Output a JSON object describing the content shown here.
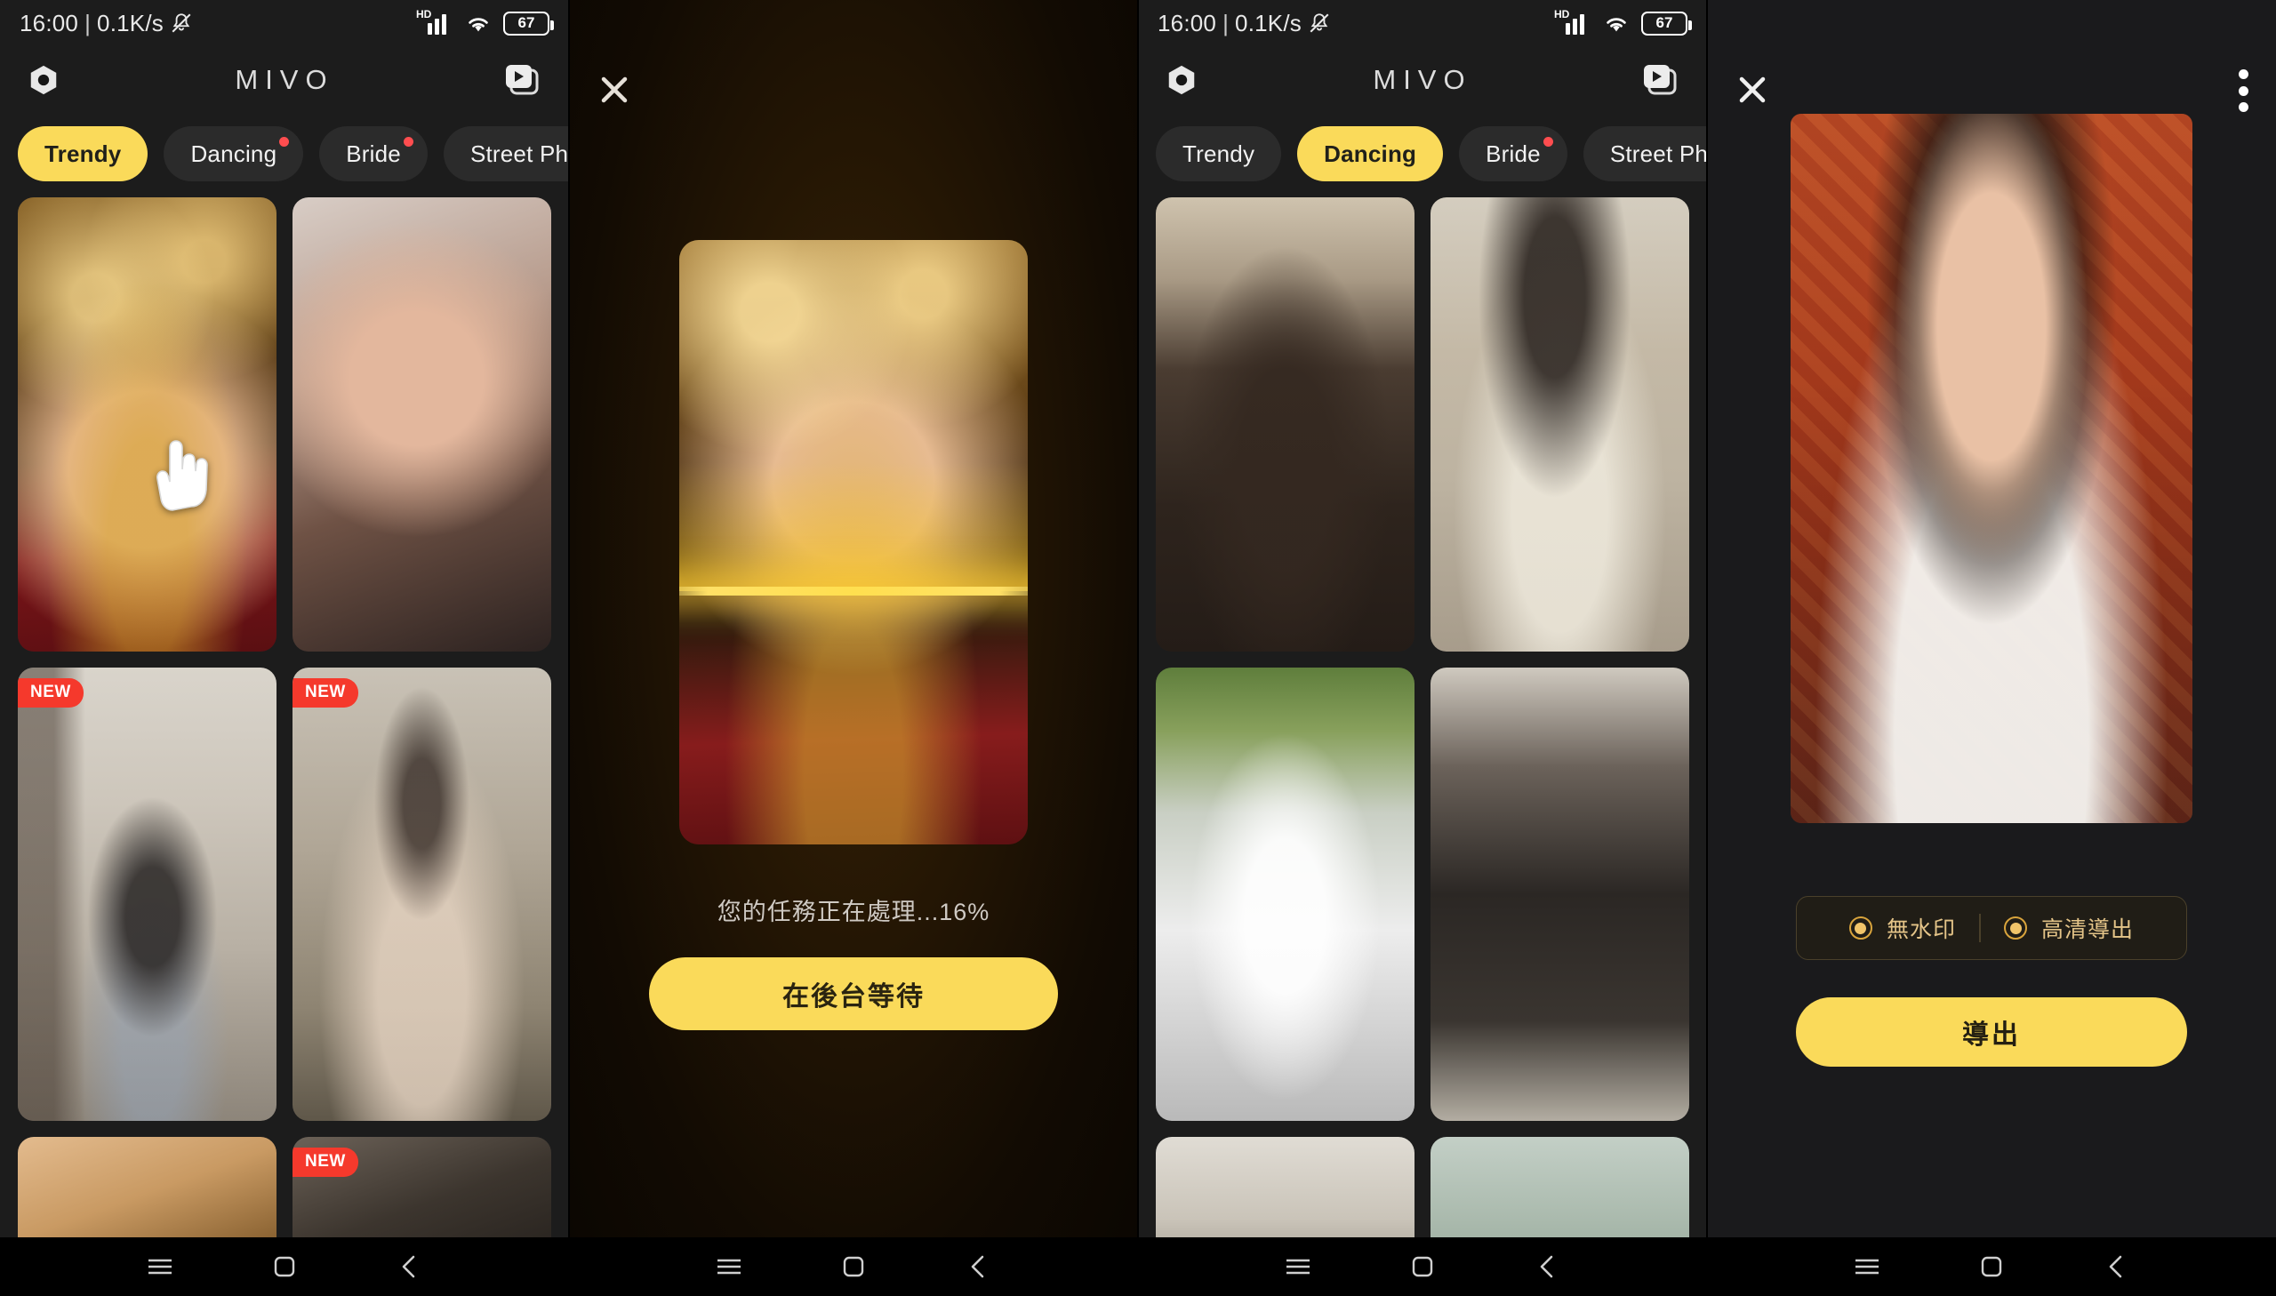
{
  "status_bar": {
    "time": "16:00",
    "separator": "|",
    "network_speed": "0.1K/s",
    "mute_icon": "bell-mute-icon",
    "signal_label": "HD",
    "signal_icon": "signal-bars-icon",
    "wifi_icon": "wifi-icon",
    "battery_level": "67"
  },
  "app": {
    "brand": "MIVO",
    "logo_icon": "hexagon-logo-icon",
    "video_button_icon": "video-stack-play-icon",
    "close_icon": "close-x-icon",
    "more_icon": "kebab-menu-icon",
    "cursor_icon": "pointing-hand-cursor-icon"
  },
  "tabs": {
    "items": [
      {
        "label": "Trendy",
        "badge": false
      },
      {
        "label": "Dancing",
        "badge": true
      },
      {
        "label": "Bride",
        "badge": true
      },
      {
        "label": "Street Photograph",
        "badge": false
      }
    ],
    "panel1_active": "Trendy",
    "panel3_active": "Dancing"
  },
  "panel1": {
    "name": "template-gallery-trendy",
    "cards": [
      {
        "id": "c1",
        "badge": "",
        "alt": "indian-bride-gold-jewelry"
      },
      {
        "id": "c2",
        "badge": "",
        "alt": "woman-portrait-hand-on-face"
      },
      {
        "id": "c3",
        "badge": "NEW",
        "alt": "woman-black-top-denim-shorts"
      },
      {
        "id": "c4",
        "badge": "NEW",
        "alt": "woman-vintage-lace-gown"
      },
      {
        "id": "c5",
        "badge": "",
        "alt": "gold-bangles-closeup"
      },
      {
        "id": "c6",
        "badge": "NEW",
        "alt": "woman-dark-hair-video"
      }
    ]
  },
  "panel2": {
    "name": "processing-overlay",
    "progress_text": "您的任務正在處理...16%",
    "progress_percent": 16,
    "wait_button": "在後台等待",
    "preview_alt": "indian-bride-gold-jewelry-processing"
  },
  "panel3": {
    "name": "template-gallery-dancing",
    "cards": [
      {
        "id": "d1",
        "badge": "",
        "alt": "young-man-brown-hoodie-dancing"
      },
      {
        "id": "d2",
        "badge": "",
        "alt": "woman-cream-sweater-hand-up"
      },
      {
        "id": "d3",
        "badge": "",
        "alt": "woman-white-tee-nyc-cap"
      },
      {
        "id": "d4",
        "badge": "",
        "alt": "woman-black-fur-jacket"
      },
      {
        "id": "d5",
        "badge": "",
        "alt": "woman-mirror-selfie"
      },
      {
        "id": "d6",
        "badge": "",
        "alt": "green-wall-clip"
      }
    ]
  },
  "panel4": {
    "name": "export-screen",
    "preview_alt": "woman-white-blouse-red-backdrop-result",
    "options": [
      {
        "label": "無水印",
        "selected": true,
        "icon": "radio-selected-icon"
      },
      {
        "label": "高清導出",
        "selected": true,
        "icon": "radio-selected-icon"
      }
    ],
    "export_button": "導出"
  },
  "nav_bar": {
    "items": [
      {
        "name": "recents-button",
        "icon": "hamburger-icon"
      },
      {
        "name": "home-button",
        "icon": "square-icon"
      },
      {
        "name": "back-button",
        "icon": "chevron-left-icon"
      }
    ]
  },
  "colors": {
    "accent": "#fada5a",
    "badge_red": "#f5392c",
    "gold_text": "#e4c488",
    "panel_bg": "#1c1c1c"
  }
}
